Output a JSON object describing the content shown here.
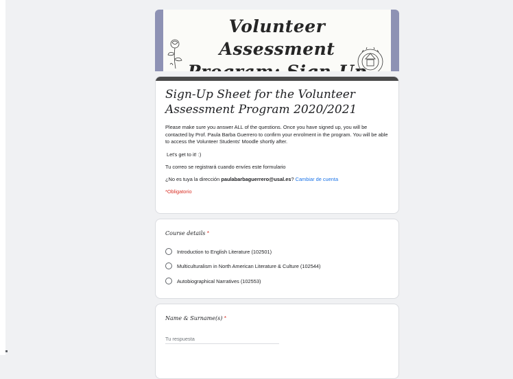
{
  "header": {
    "banner_title": "Volunteer Assessment Program: Sign-Up"
  },
  "form": {
    "title": "Sign-Up Sheet for the Volunteer Assessment Program 2020/2021",
    "description": "Please make sure you answer ALL of the questions. Once you have signed up, you will be contacted by Prof. Paula Barba Guerrero to confirm your enrolment in the program. You will be able to access the Volunteer Students' Moodle shortly after.",
    "greeting": "Let's get to it! :)",
    "email_notice": "Tu correo se registrará cuando envíes este formulario",
    "account_prefix": "¿No es tuya la dirección ",
    "account_email": "paulabarbaguerrero@usal.es",
    "account_suffix": "? ",
    "switch_account": "Cambiar de cuenta",
    "required_note": "*Obligatorio"
  },
  "questions": [
    {
      "label": "Course details",
      "required_mark": "*",
      "options": [
        "Introduction to English Literature (102501)",
        "Multiculturalism in North American Literature & Culture (102544)",
        "Autobiographical Narratives (102553)"
      ]
    },
    {
      "label": "Name & Surname(s)",
      "required_mark": "*",
      "placeholder": "Tu respuesta",
      "value": ""
    }
  ],
  "colors": {
    "banner_side": "#8e92b4",
    "title_bar": "#4a4a4a",
    "required": "#d93025",
    "link": "#1a73e8",
    "background": "#f0f1f3"
  }
}
